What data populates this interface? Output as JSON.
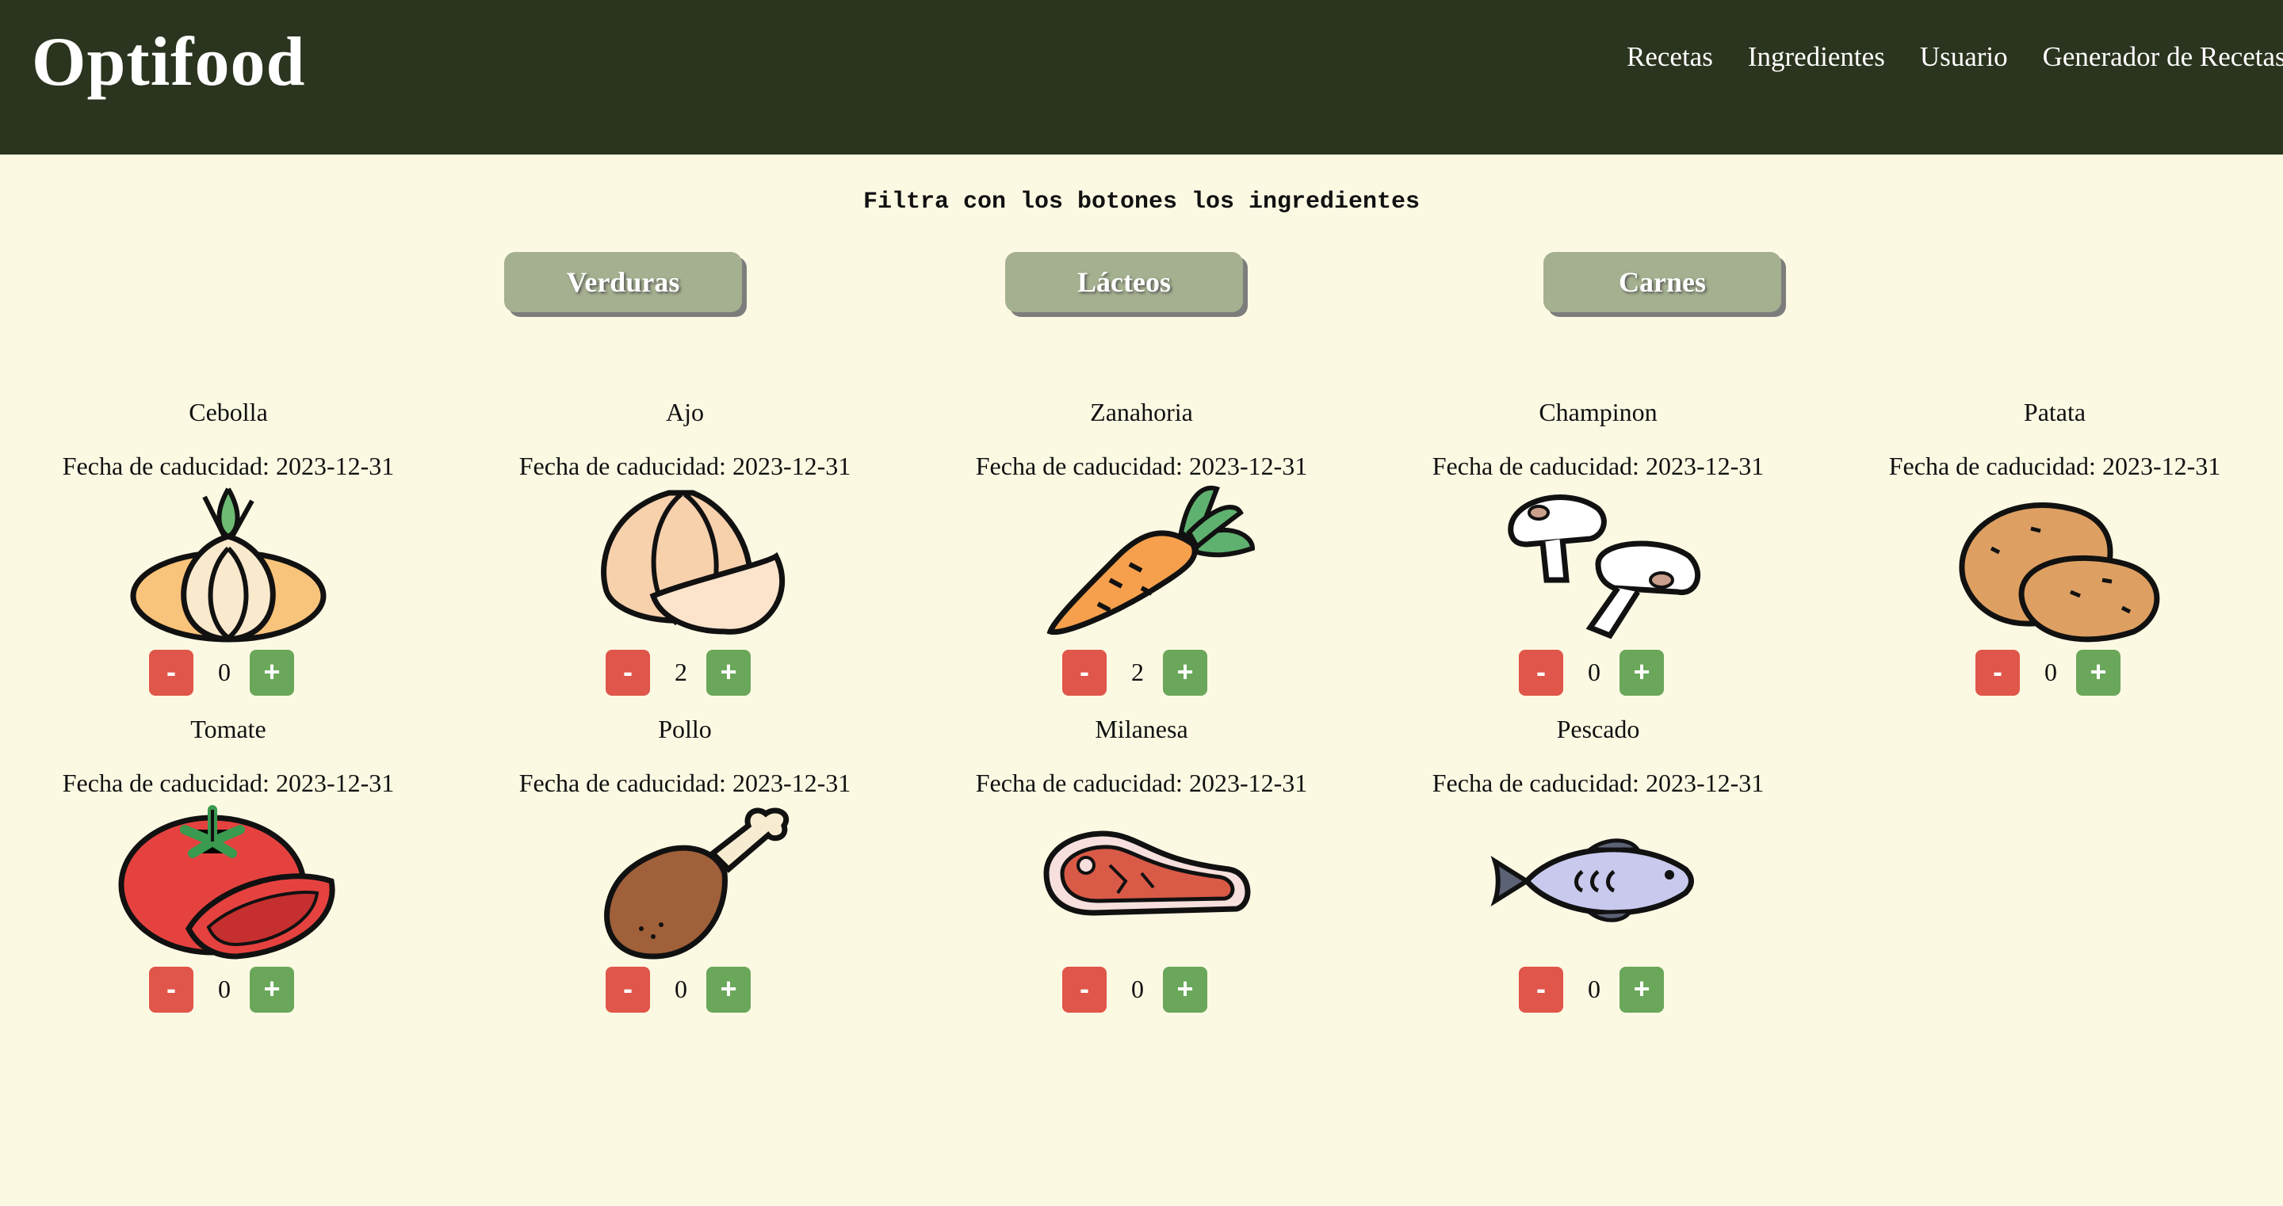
{
  "header": {
    "brand": "Optifood",
    "nav": [
      "Recetas",
      "Ingredientes",
      "Usuario",
      "Generador de Recetas"
    ]
  },
  "filter": {
    "instruction": "Filtra con los botones los ingredientes",
    "buttons": [
      "Verduras",
      "Lácteos",
      "Carnes"
    ]
  },
  "ingredients": [
    {
      "name": "Cebolla",
      "expiry": "Fecha de caducidad: 2023-12-31",
      "quantity": "0",
      "icon": "onion-icon"
    },
    {
      "name": "Ajo",
      "expiry": "Fecha de caducidad: 2023-12-31",
      "quantity": "2",
      "icon": "garlic-icon"
    },
    {
      "name": "Zanahoria",
      "expiry": "Fecha de caducidad: 2023-12-31",
      "quantity": "2",
      "icon": "carrot-icon"
    },
    {
      "name": "Champinon",
      "expiry": "Fecha de caducidad: 2023-12-31",
      "quantity": "0",
      "icon": "mushroom-icon"
    },
    {
      "name": "Patata",
      "expiry": "Fecha de caducidad: 2023-12-31",
      "quantity": "0",
      "icon": "potato-icon"
    },
    {
      "name": "Tomate",
      "expiry": "Fecha de caducidad: 2023-12-31",
      "quantity": "0",
      "icon": "tomato-icon"
    },
    {
      "name": "Pollo",
      "expiry": "Fecha de caducidad: 2023-12-31",
      "quantity": "0",
      "icon": "chicken-leg-icon"
    },
    {
      "name": "Milanesa",
      "expiry": "Fecha de caducidad: 2023-12-31",
      "quantity": "0",
      "icon": "steak-icon"
    },
    {
      "name": "Pescado",
      "expiry": "Fecha de caducidad: 2023-12-31",
      "quantity": "0",
      "icon": "fish-icon"
    }
  ],
  "controls": {
    "minus": "-",
    "plus": "+"
  },
  "colors": {
    "header_bg": "#2b341e",
    "page_bg": "#fcf9e3",
    "filter_button": "#a4b08f",
    "minus_button": "#e0564a",
    "plus_button": "#6aa75a"
  }
}
